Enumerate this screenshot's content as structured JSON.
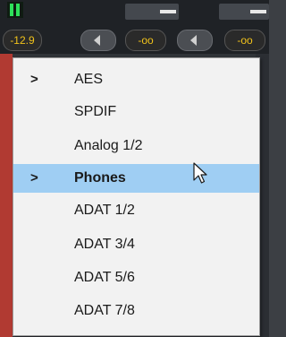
{
  "mixer": {
    "channels": [
      {
        "value": "-12.9"
      },
      {
        "value": "-oo"
      },
      {
        "value": "-oo"
      }
    ]
  },
  "menu": {
    "items": [
      {
        "label": "AES",
        "has_submenu": true,
        "arrow": ">"
      },
      {
        "label": "SPDIF",
        "has_submenu": false,
        "arrow": ""
      },
      {
        "label": "Analog 1/2",
        "has_submenu": false,
        "arrow": ""
      },
      {
        "label": "Phones",
        "has_submenu": true,
        "arrow": ">",
        "selected": true
      },
      {
        "label": "ADAT 1/2",
        "has_submenu": false,
        "arrow": ""
      },
      {
        "label": "ADAT 3/4",
        "has_submenu": false,
        "arrow": ""
      },
      {
        "label": "ADAT 5/6",
        "has_submenu": false,
        "arrow": ""
      },
      {
        "label": "ADAT 7/8",
        "has_submenu": false,
        "arrow": ""
      }
    ],
    "highlight_color": "#9fcef3"
  },
  "icons": {
    "cursor": "mouse-pointer-icon",
    "pan_left": "triangle-left-icon"
  }
}
